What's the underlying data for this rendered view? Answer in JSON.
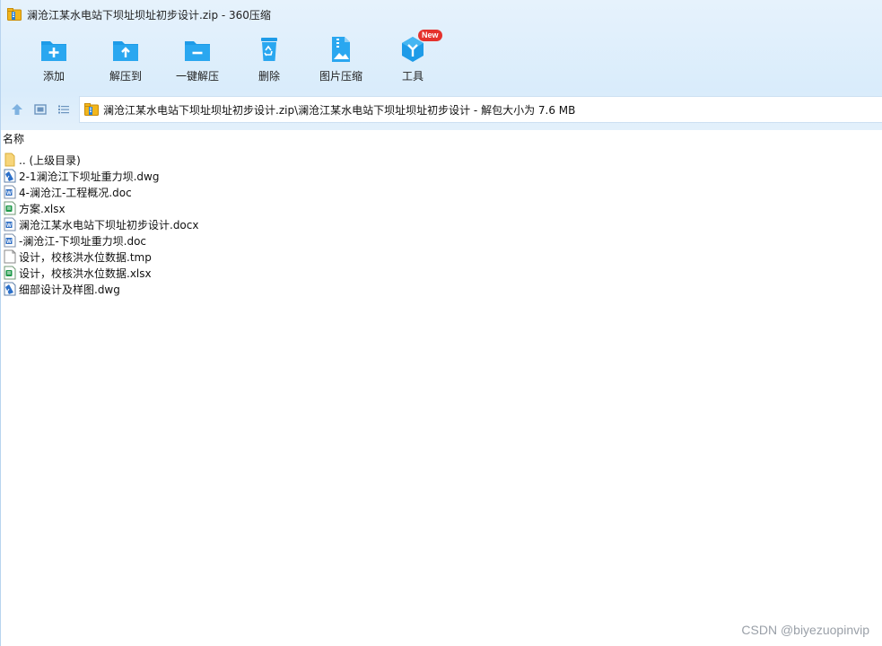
{
  "window": {
    "title": "澜沧江某水电站下坝址坝址初步设计.zip - 360压缩",
    "title_icon": "archive-icon"
  },
  "toolbar": {
    "items": [
      {
        "label": "添加",
        "icon": "add-folder-icon"
      },
      {
        "label": "解压到",
        "icon": "extract-to-icon"
      },
      {
        "label": "一键解压",
        "icon": "one-click-extract-icon"
      },
      {
        "label": "删除",
        "icon": "recycle-bin-icon"
      },
      {
        "label": "图片压缩",
        "icon": "image-compress-icon"
      },
      {
        "label": "工具",
        "icon": "tools-icon",
        "badge": "New"
      }
    ]
  },
  "address": {
    "path": "澜沧江某水电站下坝址坝址初步设计.zip\\澜沧江某水电站下坝址坝址初步设计 - 解包大小为 7.6 MB"
  },
  "list": {
    "column_name": "名称",
    "files": [
      {
        "name": ".. (上级目录)",
        "type": "folder"
      },
      {
        "name": "2-1澜沧江下坝址重力坝.dwg",
        "type": "dwg"
      },
      {
        "name": "4-澜沧江-工程概况.doc",
        "type": "doc"
      },
      {
        "name": "方案.xlsx",
        "type": "xlsx"
      },
      {
        "name": "澜沧江某水电站下坝址初步设计.docx",
        "type": "doc"
      },
      {
        "name": "-澜沧江-下坝址重力坝.doc",
        "type": "doc"
      },
      {
        "name": "设计，校核洪水位数据.tmp",
        "type": "tmp"
      },
      {
        "name": "设计，校核洪水位数据.xlsx",
        "type": "xlsx"
      },
      {
        "name": "细部设计及样图.dwg",
        "type": "dwg"
      }
    ]
  },
  "watermark": "CSDN @biyezuopinvip",
  "colors": {
    "accent": "#1e9be8",
    "badge": "#e5322d",
    "band": "#d9ecfb"
  }
}
